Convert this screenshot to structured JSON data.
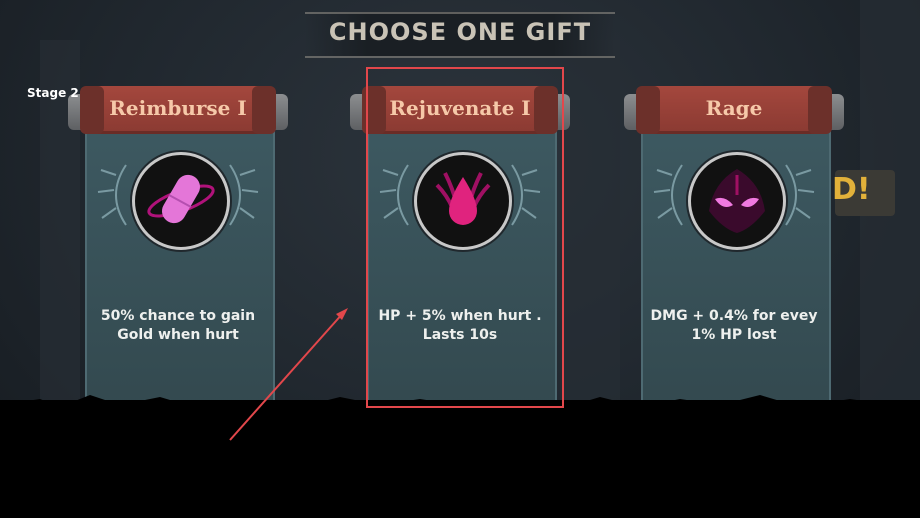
{
  "header": {
    "title": "CHOOSE ONE GIFT"
  },
  "stage_label": "Stage 2",
  "cards": [
    {
      "title": "Reimburse I",
      "icon": "capsule-icon",
      "description_line1": "50% chance to gain",
      "description_line2": "Gold when hurt"
    },
    {
      "title": "Rejuvenate I",
      "icon": "blood-drop-icon",
      "description_line1": "HP + 5% when hurt .",
      "description_line2": "Lasts 10s"
    },
    {
      "title": "Rage",
      "icon": "rage-eyes-icon",
      "description_line1": "DMG + 0.4% for evey",
      "description_line2": "1% HP lost"
    }
  ],
  "colors": {
    "banner": "#9a4238",
    "banner_text": "#f6c9a9",
    "scroll": "#3a555c",
    "icon_magenta": "#e0237e",
    "highlight": "#e2474b"
  }
}
